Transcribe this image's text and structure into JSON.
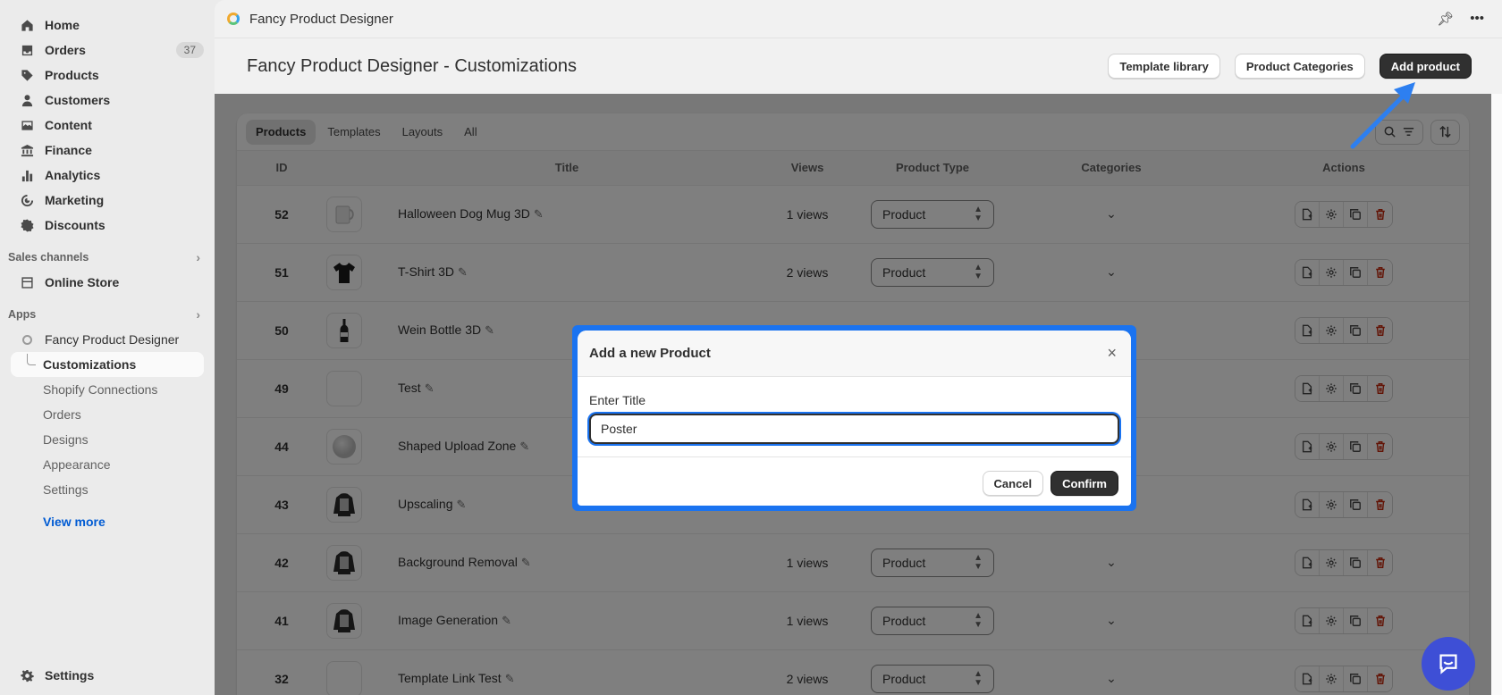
{
  "sidebar": {
    "items": [
      {
        "label": "Home",
        "icon": "home-icon"
      },
      {
        "label": "Orders",
        "icon": "orders-icon",
        "badge": "37"
      },
      {
        "label": "Products",
        "icon": "tag-icon"
      },
      {
        "label": "Customers",
        "icon": "person-icon"
      },
      {
        "label": "Content",
        "icon": "content-icon"
      },
      {
        "label": "Finance",
        "icon": "bank-icon"
      },
      {
        "label": "Analytics",
        "icon": "chart-icon"
      },
      {
        "label": "Marketing",
        "icon": "target-icon"
      },
      {
        "label": "Discounts",
        "icon": "discount-icon"
      }
    ],
    "sales_channels": {
      "header": "Sales channels",
      "online_store": "Online Store"
    },
    "apps": {
      "header": "Apps",
      "app_name": "Fancy Product Designer",
      "sub_items": [
        "Customizations",
        "Shopify Connections",
        "Orders",
        "Designs",
        "Appearance",
        "Settings"
      ],
      "view_more": "View more"
    },
    "settings": "Settings"
  },
  "topbar": {
    "title": "Fancy Product Designer"
  },
  "header": {
    "title": "Fancy Product Designer - Customizations",
    "template_library": "Template library",
    "product_categories": "Product Categories",
    "add_product": "Add product"
  },
  "tabs": [
    "Products",
    "Templates",
    "Layouts",
    "All"
  ],
  "table": {
    "columns": [
      "ID",
      "Title",
      "Views",
      "Product Type",
      "Categories",
      "Actions"
    ],
    "rows": [
      {
        "id": "52",
        "title": "Halloween Dog Mug 3D",
        "views": "1 views",
        "type": "Product",
        "thumb": "mug"
      },
      {
        "id": "51",
        "title": "T-Shirt 3D",
        "views": "2 views",
        "type": "Product",
        "thumb": "tshirt"
      },
      {
        "id": "50",
        "title": "Wein Bottle 3D",
        "views": "",
        "type": "",
        "thumb": "bottle"
      },
      {
        "id": "49",
        "title": "Test",
        "views": "",
        "type": "",
        "thumb": "blank"
      },
      {
        "id": "44",
        "title": "Shaped Upload Zone",
        "views": "",
        "type": "",
        "thumb": "circle"
      },
      {
        "id": "43",
        "title": "Upscaling",
        "views": "",
        "type": "",
        "thumb": "hoodie"
      },
      {
        "id": "42",
        "title": "Background Removal",
        "views": "1 views",
        "type": "Product",
        "thumb": "hoodie"
      },
      {
        "id": "41",
        "title": "Image Generation",
        "views": "1 views",
        "type": "Product",
        "thumb": "hoodie"
      },
      {
        "id": "32",
        "title": "Template Link Test",
        "views": "2 views",
        "type": "Product",
        "thumb": "blank"
      }
    ]
  },
  "modal": {
    "title": "Add a new Product",
    "field_label": "Enter Title",
    "field_value": "Poster",
    "cancel": "Cancel",
    "confirm": "Confirm"
  },
  "colors": {
    "accent": "#1a73f0",
    "primary_button": "#303030",
    "link": "#005bd3",
    "danger": "#c5280c"
  }
}
